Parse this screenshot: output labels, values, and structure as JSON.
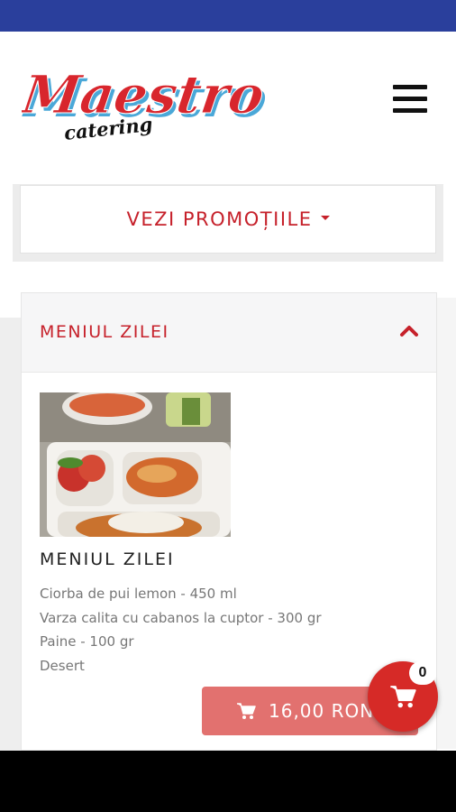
{
  "header": {
    "logo_text": "Maestro",
    "logo_subtext": "catering",
    "menu_icon": "hamburger-menu-icon"
  },
  "promo": {
    "label": "VEZI PROMOȚIILE",
    "icon": "caret-down-icon"
  },
  "section": {
    "title": "MENIUL ZILEI",
    "icon": "chevron-up-icon"
  },
  "item": {
    "title": "MENIUL ZILEI",
    "description": [
      "Ciorba de pui lemon - 450 ml",
      "Varza calita cu cabanos la cuptor - 300 gr",
      "Paine - 100 gr",
      "Desert"
    ],
    "price": "16,00 RON",
    "price_icon": "shopping-cart-icon"
  },
  "cart": {
    "count": "0",
    "icon": "shopping-cart-icon"
  },
  "colors": {
    "status_bar": "#2a3f9c",
    "accent_red": "#c6212b",
    "price_button": "#e2716f",
    "fab": "#d62a27"
  }
}
